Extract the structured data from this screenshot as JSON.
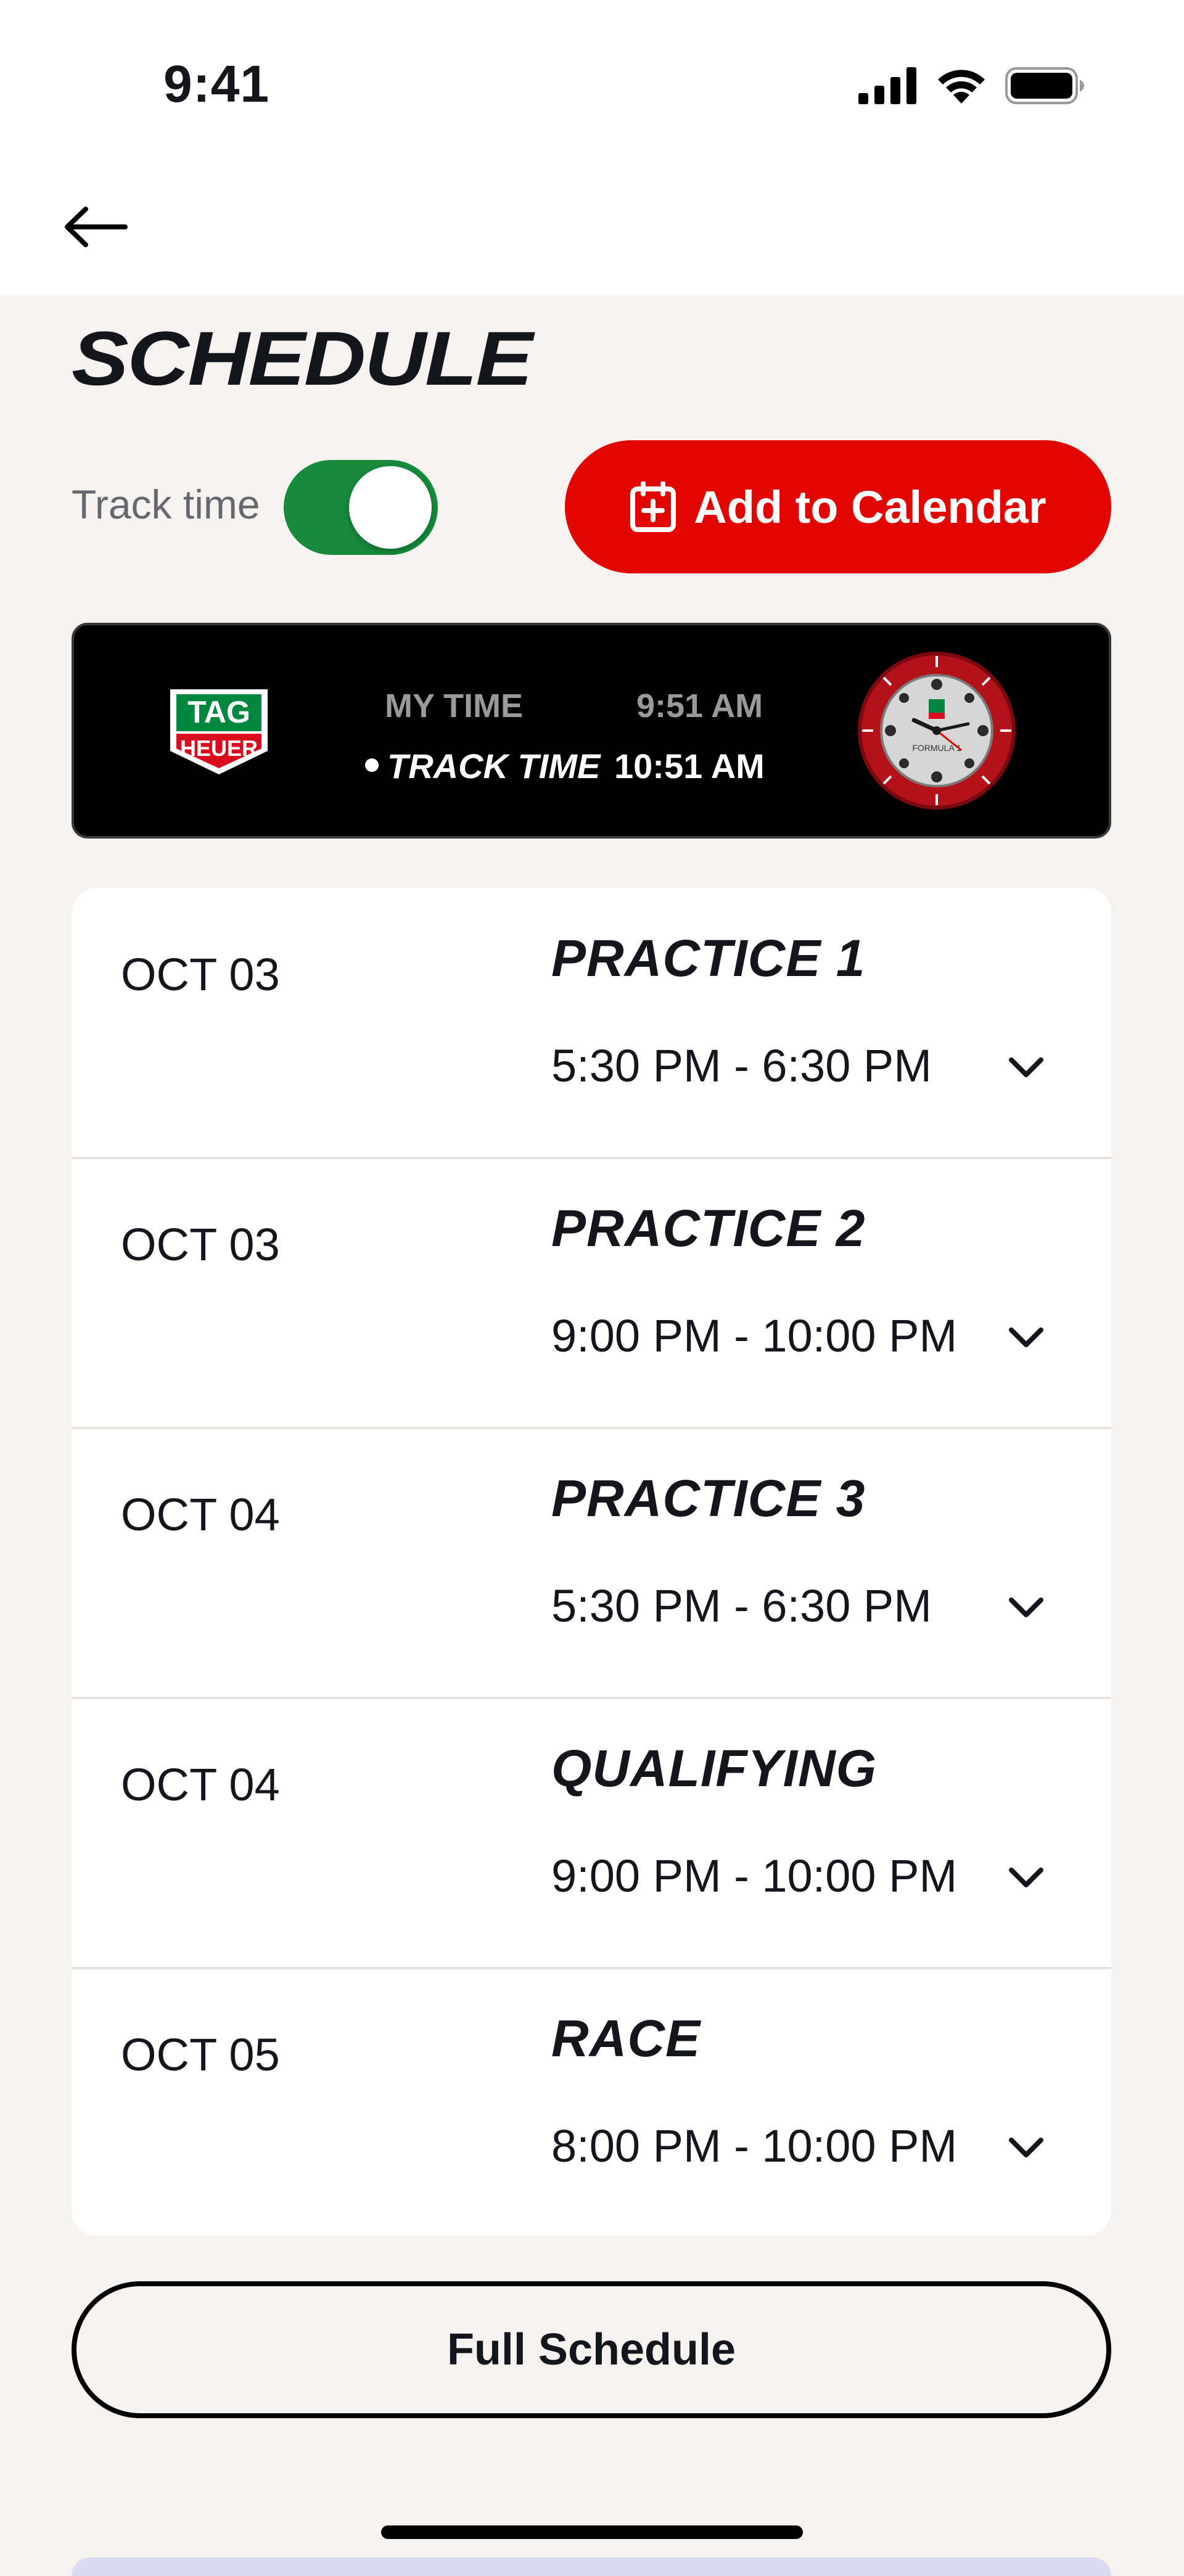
{
  "status_bar": {
    "time": "9:41"
  },
  "page": {
    "title": "SCHEDULE"
  },
  "controls": {
    "track_time_label": "Track time",
    "track_time_enabled": true,
    "add_to_calendar_label": "Add to Calendar"
  },
  "tag_banner": {
    "my_time_label": "MY TIME",
    "my_time_value": "9:51 AM",
    "track_time_label": "TRACK TIME",
    "track_time_value": "10:51 AM",
    "logo_line1": "TAG",
    "logo_line2": "HEUER",
    "watch_dial_text": "FORMULA 1"
  },
  "sessions": [
    {
      "date": "OCT 03",
      "name": "PRACTICE 1",
      "time": "5:30 PM - 6:30 PM"
    },
    {
      "date": "OCT 03",
      "name": "PRACTICE 2",
      "time": "9:00 PM - 10:00 PM"
    },
    {
      "date": "OCT 04",
      "name": "PRACTICE 3",
      "time": "5:30 PM - 6:30 PM"
    },
    {
      "date": "OCT 04",
      "name": "QUALIFYING",
      "time": "9:00 PM - 10:00 PM"
    },
    {
      "date": "OCT 05",
      "name": "RACE",
      "time": "8:00 PM - 10:00 PM"
    }
  ],
  "footer": {
    "full_schedule_label": "Full Schedule"
  },
  "colors": {
    "accent_red": "#e10600",
    "toggle_green": "#178a3b",
    "background": "#f5f2ef"
  },
  "icons": {
    "back": "arrow-left-icon",
    "calendar_add": "calendar-plus-icon",
    "chevron": "chevron-down-icon"
  }
}
